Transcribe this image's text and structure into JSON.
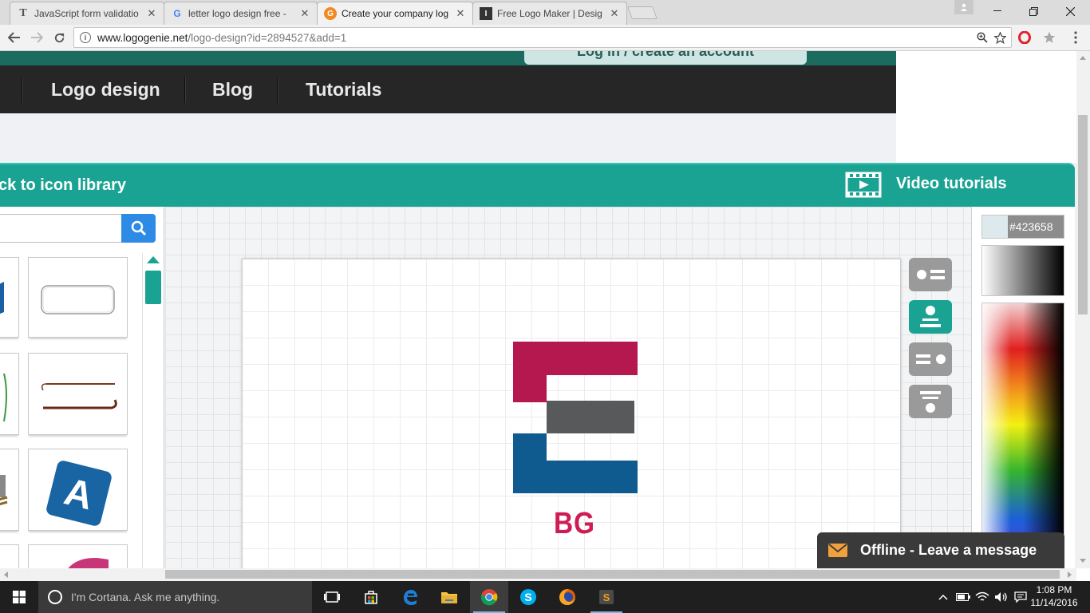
{
  "browser": {
    "tabs": [
      {
        "title": "JavaScript form validatio",
        "icon": "T"
      },
      {
        "title": "letter logo design free - ",
        "icon": "G"
      },
      {
        "title": "Create your company log",
        "icon": "G"
      },
      {
        "title": "Free Logo Maker | Desig",
        "icon": "I"
      }
    ],
    "close_glyph": "✕",
    "url_host": "www.logogenie.net",
    "url_path": "/logo-design?id=2894527&add=1"
  },
  "site": {
    "login_label": "Log in / create an account",
    "nav": [
      "Logo design",
      "Blog",
      "Tutorials"
    ],
    "back_label": "ck to icon library",
    "video_label": "Video tutorials"
  },
  "editor": {
    "logo_text": "BG",
    "logo_colors": {
      "top": "#b5174f",
      "middle": "#58595b",
      "bottom": "#0f5a8f",
      "text": "#d01c54"
    },
    "hex_value": "#423658",
    "offline_label": "Offline - Leave a message"
  },
  "taskbar": {
    "cortana_placeholder": "I'm Cortana. Ask me anything.",
    "time": "1:08 PM",
    "date": "11/14/2016"
  }
}
